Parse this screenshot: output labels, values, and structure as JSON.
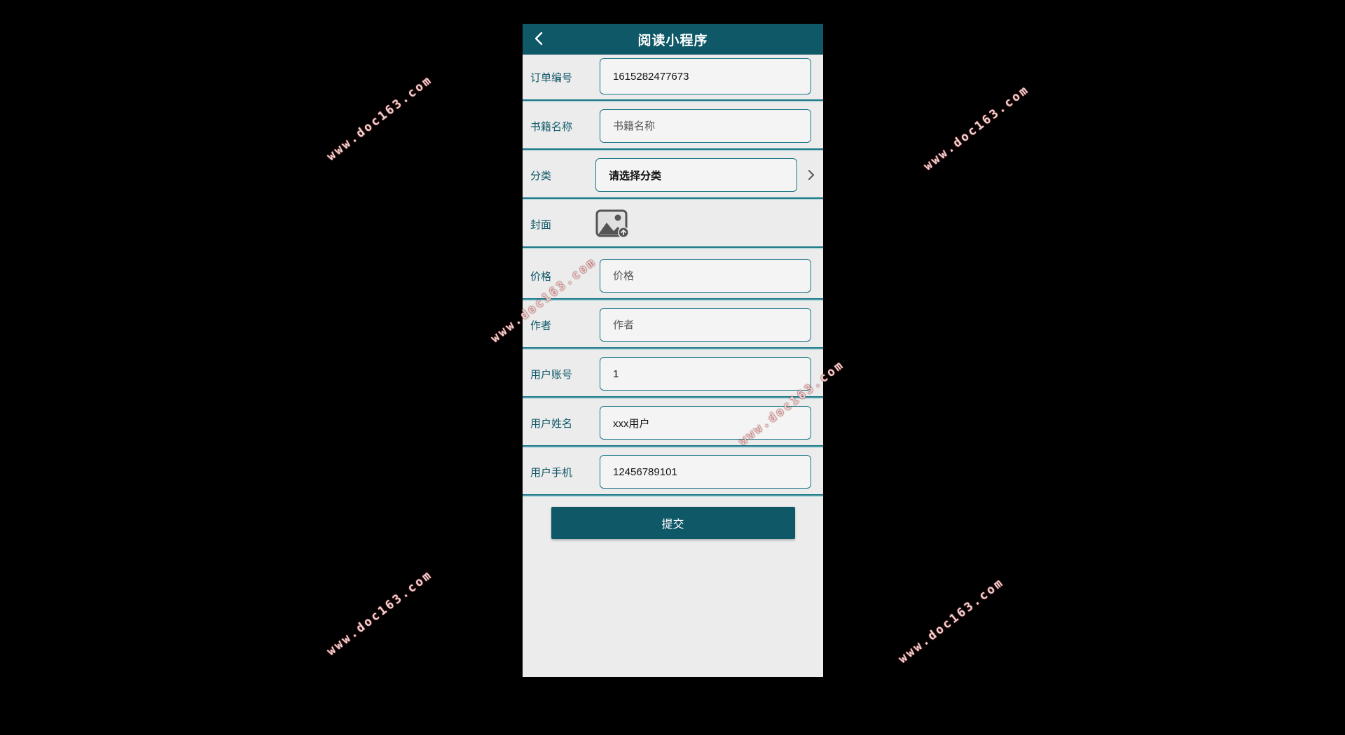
{
  "header": {
    "title": "阅读小程序"
  },
  "form": {
    "order_no": {
      "label": "订单编号",
      "value": "1615282477673"
    },
    "book_name": {
      "label": "书籍名称",
      "placeholder": "书籍名称"
    },
    "category": {
      "label": "分类",
      "value": "请选择分类"
    },
    "cover": {
      "label": "封面"
    },
    "price": {
      "label": "价格",
      "placeholder": "价格"
    },
    "author": {
      "label": "作者",
      "placeholder": "作者"
    },
    "user_account": {
      "label": "用户账号",
      "value": "1"
    },
    "user_name": {
      "label": "用户姓名",
      "value": "xxx用户"
    },
    "user_phone": {
      "label": "用户手机",
      "value": "12456789101"
    }
  },
  "submit_label": "提交",
  "watermark_text": "www.doc163.com",
  "colors": {
    "primary": "#0f5868",
    "border": "#1a7787",
    "background": "#ececec",
    "outer": "#000000"
  }
}
